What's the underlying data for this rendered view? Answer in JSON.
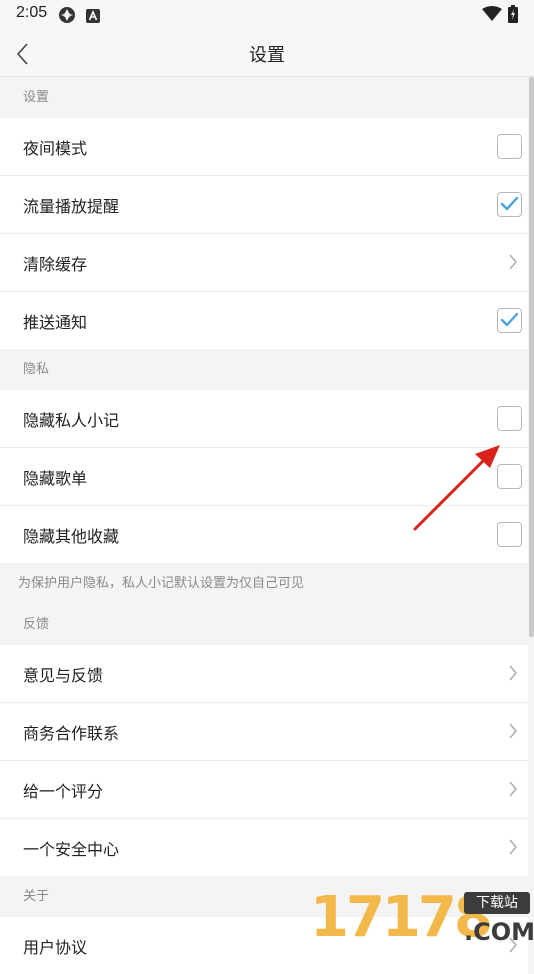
{
  "status_bar": {
    "time": "2:05"
  },
  "header": {
    "title": "设置"
  },
  "sections": [
    {
      "header": "设置",
      "rows": [
        {
          "label": "夜间模式",
          "control": "checkbox",
          "checked": false
        },
        {
          "label": "流量播放提醒",
          "control": "checkbox",
          "checked": true
        },
        {
          "label": "清除缓存",
          "control": "chevron"
        },
        {
          "label": "推送通知",
          "control": "checkbox",
          "checked": true
        }
      ]
    },
    {
      "header": "隐私",
      "rows": [
        {
          "label": "隐藏私人小记",
          "control": "checkbox",
          "checked": false
        },
        {
          "label": "隐藏歌单",
          "control": "checkbox",
          "checked": false
        },
        {
          "label": "隐藏其他收藏",
          "control": "checkbox",
          "checked": false
        }
      ],
      "note": "为保护用户隐私，私人小记默认设置为仅自己可见"
    },
    {
      "header": "反馈",
      "rows": [
        {
          "label": "意见与反馈",
          "control": "chevron"
        },
        {
          "label": "商务合作联系",
          "control": "chevron"
        },
        {
          "label": "给一个评分",
          "control": "chevron"
        },
        {
          "label": "一个安全中心",
          "control": "chevron"
        }
      ]
    },
    {
      "header": "关于",
      "rows": [
        {
          "label": "用户协议",
          "control": "chevron"
        }
      ]
    }
  ],
  "watermark": {
    "digits": "17178",
    "badge": "下载站",
    "domain": ".COM"
  },
  "colors": {
    "check_accent": "#4aa3df",
    "annotation_arrow": "#d9221c",
    "watermark_orange": "#f2b84a"
  },
  "icons": {
    "back": "chevron-left-icon",
    "chevron": "chevron-right-icon",
    "check": "check-icon"
  }
}
